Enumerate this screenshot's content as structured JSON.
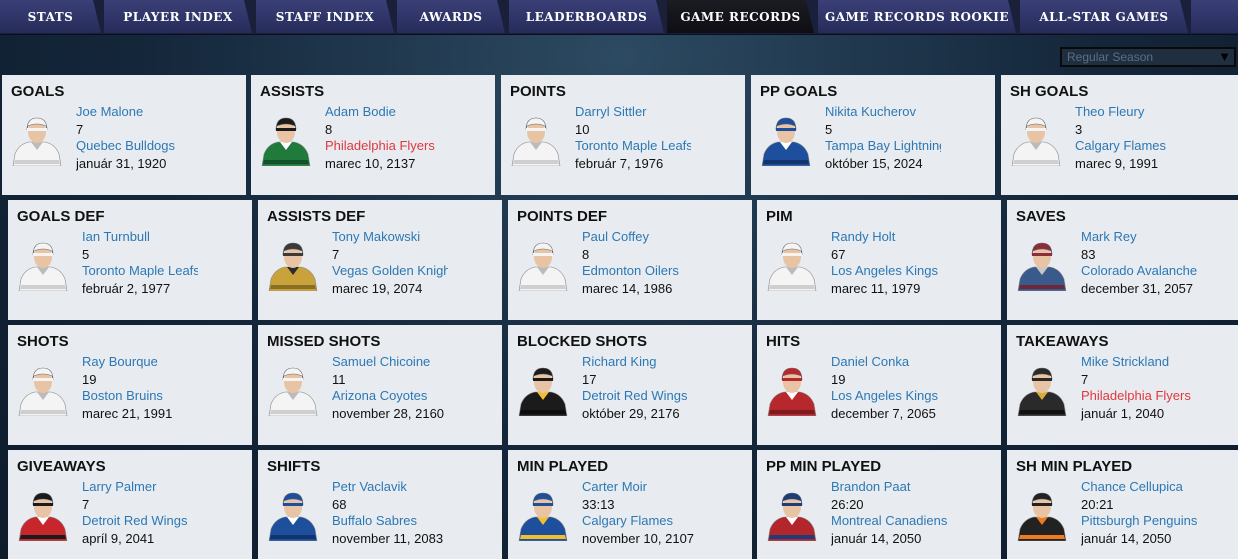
{
  "nav": {
    "tabs": [
      {
        "label": "STATS",
        "active": false
      },
      {
        "label": "PLAYER INDEX",
        "active": false
      },
      {
        "label": "STAFF INDEX",
        "active": false
      },
      {
        "label": "AWARDS",
        "active": false
      },
      {
        "label": "LEADERBOARDS",
        "active": false
      },
      {
        "label": "GAME RECORDS",
        "active": true
      },
      {
        "label": "GAME RECORDS ROOKIE",
        "active": false
      },
      {
        "label": "ALL-STAR GAMES",
        "active": false
      },
      {
        "label": "",
        "active": false
      }
    ]
  },
  "season_select": {
    "value": "Regular Season",
    "icon": "dropdown-arrow-icon"
  },
  "records": [
    {
      "title": "GOALS",
      "player": "Joe Malone",
      "value": "7",
      "team": "Quebec Bulldogs",
      "team_color": "#2c78b4",
      "date": "január 31, 1920",
      "jersey": "white"
    },
    {
      "title": "ASSISTS",
      "player": "Adam Bodie",
      "value": "8",
      "team": "Philadelphia Flyers",
      "team_color": "#e0383e",
      "date": "marec 10, 2137",
      "jersey": "green"
    },
    {
      "title": "POINTS",
      "player": "Darryl Sittler",
      "value": "10",
      "team": "Toronto Maple Leafs",
      "team_color": "#2c78b4",
      "date": "február 7, 1976",
      "jersey": "white"
    },
    {
      "title": "PP GOALS",
      "player": "Nikita Kucherov",
      "value": "5",
      "team": "Tampa Bay Lightning",
      "team_color": "#2c78b4",
      "date": "október 15, 2024",
      "jersey": "blue"
    },
    {
      "title": "SH GOALS",
      "player": "Theo Fleury",
      "value": "3",
      "team": "Calgary Flames",
      "team_color": "#2c78b4",
      "date": "marec 9, 1991",
      "jersey": "white"
    },
    {
      "title": "GOALS DEF",
      "player": "Ian Turnbull",
      "value": "5",
      "team": "Toronto Maple Leafs",
      "team_color": "#2c78b4",
      "date": "február 2, 1977",
      "jersey": "white"
    },
    {
      "title": "ASSISTS DEF",
      "player": "Tony Makowski",
      "value": "7",
      "team": "Vegas Golden Knights",
      "team_color": "#2c78b4",
      "date": "marec 19, 2074",
      "jersey": "gold"
    },
    {
      "title": "POINTS DEF",
      "player": "Paul Coffey",
      "value": "8",
      "team": "Edmonton Oilers",
      "team_color": "#2c78b4",
      "date": "marec 14, 1986",
      "jersey": "white"
    },
    {
      "title": "PIM",
      "player": "Randy Holt",
      "value": "67",
      "team": "Los Angeles Kings",
      "team_color": "#2c78b4",
      "date": "marec 11, 1979",
      "jersey": "white"
    },
    {
      "title": "SAVES",
      "player": "Mark Rey",
      "value": "83",
      "team": "Colorado Avalanche",
      "team_color": "#2c78b4",
      "date": "december 31, 2057",
      "jersey": "colorado"
    },
    {
      "title": "SHOTS",
      "player": "Ray Bourque",
      "value": "19",
      "team": "Boston Bruins",
      "team_color": "#2c78b4",
      "date": "marec 21, 1991",
      "jersey": "white"
    },
    {
      "title": "MISSED SHOTS",
      "player": "Samuel Chicoine",
      "value": "11",
      "team": "Arizona Coyotes",
      "team_color": "#2c78b4",
      "date": "november 28, 2160",
      "jersey": "white"
    },
    {
      "title": "BLOCKED SHOTS",
      "player": "Richard King",
      "value": "17",
      "team": "Detroit Red Wings",
      "team_color": "#2c78b4",
      "date": "október 29, 2176",
      "jersey": "pittsburgh"
    },
    {
      "title": "HITS",
      "player": "Daniel Conka",
      "value": "19",
      "team": "Los Angeles Kings",
      "team_color": "#2c78b4",
      "date": "december 7, 2065",
      "jersey": "red"
    },
    {
      "title": "TAKEAWAYS",
      "player": "Mike Strickland",
      "value": "7",
      "team": "Philadelphia Flyers",
      "team_color": "#e0383e",
      "date": "január 1, 2040",
      "jersey": "black"
    },
    {
      "title": "GIVEAWAYS",
      "player": "Larry Palmer",
      "value": "7",
      "team": "Detroit Red Wings",
      "team_color": "#2c78b4",
      "date": "apríl 9, 2041",
      "jersey": "carolina"
    },
    {
      "title": "SHIFTS",
      "player": "Petr Vaclavik",
      "value": "68",
      "team": "Buffalo Sabres",
      "team_color": "#2c78b4",
      "date": "november 11, 2083",
      "jersey": "blue"
    },
    {
      "title": "MIN PLAYED",
      "player": "Carter Moir",
      "value": "33:13",
      "team": "Calgary Flames",
      "team_color": "#2c78b4",
      "date": "november 10, 2107",
      "jersey": "stlouis"
    },
    {
      "title": "PP MIN PLAYED",
      "player": "Brandon Paat",
      "value": "26:20",
      "team": "Montreal Canadiens",
      "team_color": "#2c78b4",
      "date": "január 14, 2050",
      "jersey": "montreal"
    },
    {
      "title": "SH MIN PLAYED",
      "player": "Chance Cellupica",
      "value": "20:21",
      "team": "Pittsburgh Penguins",
      "team_color": "#2c78b4",
      "date": "január 14, 2050",
      "jersey": "orange"
    }
  ]
}
